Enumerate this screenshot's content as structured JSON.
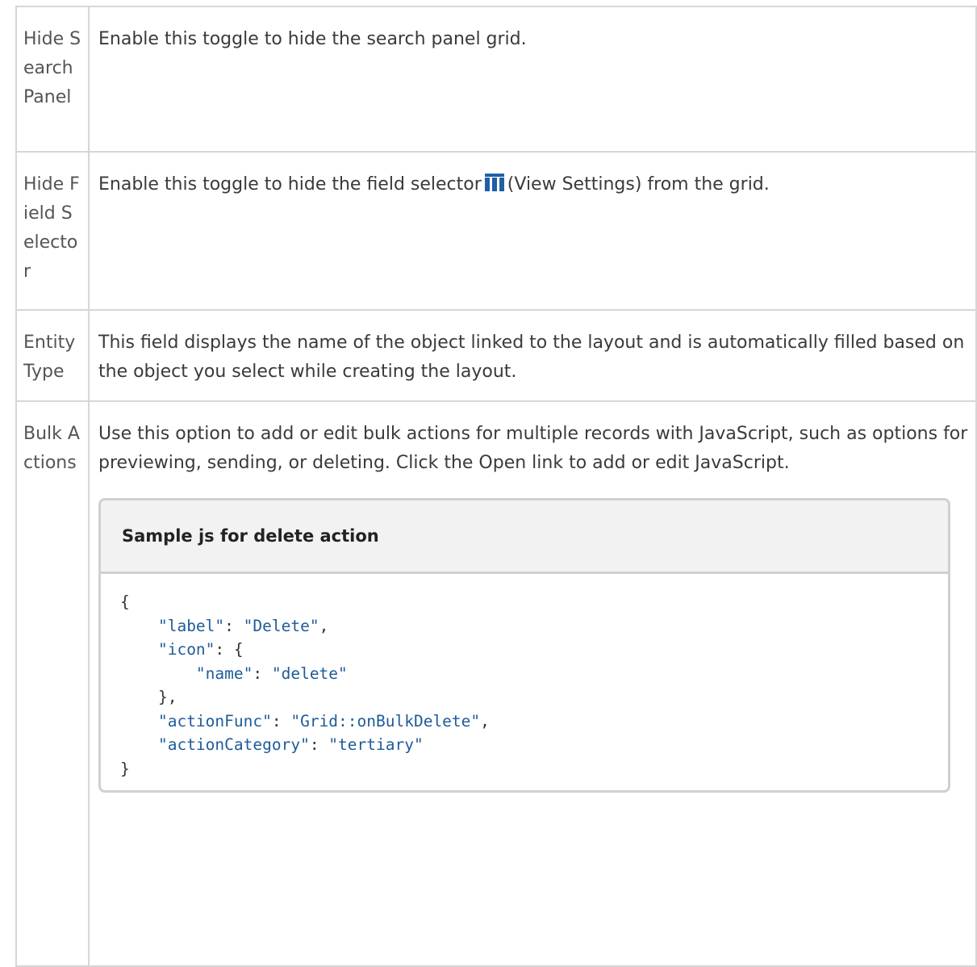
{
  "rows": [
    {
      "name": "Hide Search Panel",
      "description": "Enable this toggle to hide the search panel grid."
    },
    {
      "name": "Hide Field Selector",
      "description_before_icon": "Enable this toggle to hide the field selector",
      "icon": "view-settings-columns-icon",
      "description_after_icon": "(View Settings) from the grid."
    },
    {
      "name": "Entity Type",
      "description": "This field displays the name of the object linked to the layout and is automatically filled based on the object you select while creating the layout."
    },
    {
      "name": "Bulk Actions",
      "description": "Use this option to add or edit bulk actions for multiple records with JavaScript, such as options for previewing, sending, or deleting. Click the Open link to add or edit JavaScript.",
      "code_sample": {
        "title": "Sample js for delete action",
        "lines": [
          "{",
          "    \"label\": \"Delete\",",
          "    \"icon\": {",
          "        \"name\": \"delete\"",
          "    },",
          "    \"actionFunc\": \"Grid::onBulkDelete\",",
          "    \"actionCategory\": \"tertiary\"",
          "}"
        ]
      }
    }
  ],
  "colors": {
    "border": "#d6d6d6",
    "text": "#333333",
    "code_string": "#1f5b99",
    "icon": "#1f5fa6"
  }
}
